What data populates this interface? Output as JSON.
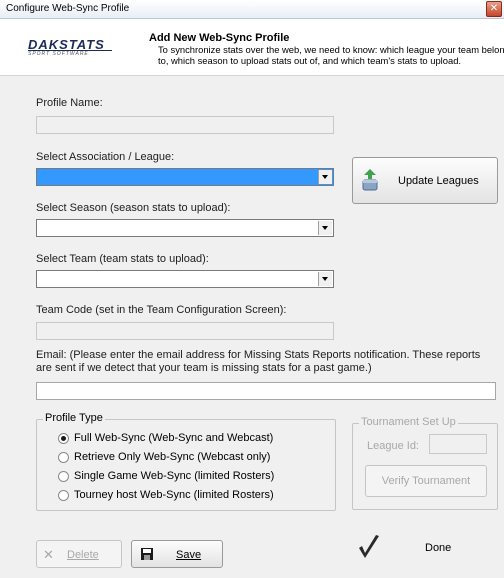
{
  "window": {
    "title": "Configure Web-Sync Profile",
    "close": "✕"
  },
  "header": {
    "logo_text": "DAKSTATS",
    "logo_sub": "SPORT SOFTWARE",
    "title": "Add New Web-Sync Profile",
    "desc_line1": "To synchronize stats over the web, we need to know: which league your team belon",
    "desc_line2": "to, which season to upload stats out of, and which team's stats to upload."
  },
  "form": {
    "profile_name_label": "Profile Name:",
    "profile_name_value": "",
    "association_label": "Select Association / League:",
    "association_value": "",
    "update_leagues_label": "Update Leagues",
    "season_label": "Select Season (season stats to upload):",
    "season_value": "",
    "team_label": "Select Team (team stats to upload):",
    "team_value": "",
    "team_code_label": "Team Code  (set in the Team Configuration Screen):",
    "team_code_value": "",
    "email_label_line1": "Email: (Please enter the email address for Missing Stats Reports notification. These reports",
    "email_label_line2": "are sent if we detect that your team is missing stats for a past game.)",
    "email_value": ""
  },
  "profile_type": {
    "legend": "Profile Type",
    "options": [
      {
        "label": "Full Web-Sync (Web-Sync and Webcast)",
        "selected": true
      },
      {
        "label": "Retrieve Only Web-Sync (Webcast only)",
        "selected": false
      },
      {
        "label": "Single Game Web-Sync (limited Rosters)",
        "selected": false
      },
      {
        "label": "Tourney host Web-Sync (limited Rosters)",
        "selected": false
      }
    ]
  },
  "tournament": {
    "legend": "Tournament Set Up",
    "league_id_label": "League Id:",
    "league_id_value": "",
    "verify_label": "Verify Tournament"
  },
  "footer": {
    "delete_label": "Delete",
    "save_label": "Save",
    "done_label": "Done"
  },
  "colors": {
    "selection": "#3399ff",
    "window_bg": "#f0f0f0",
    "close_red": "#c3462b"
  }
}
